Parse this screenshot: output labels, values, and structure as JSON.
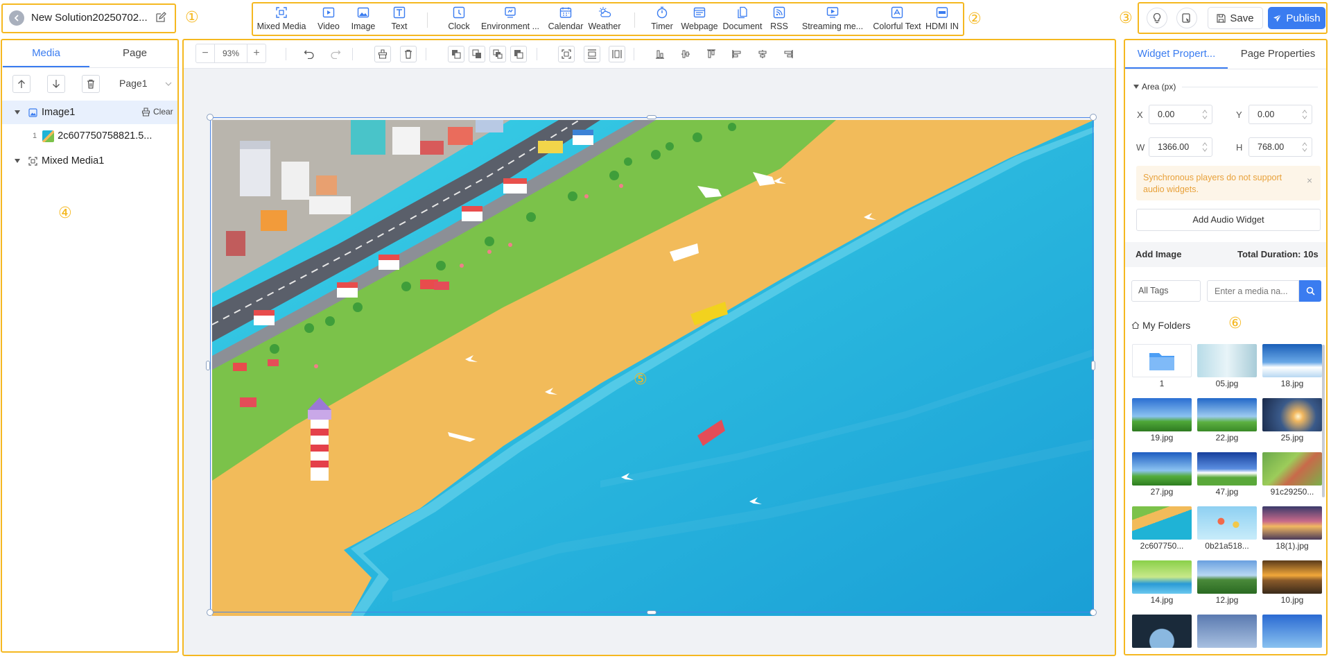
{
  "header": {
    "solution_title": "New Solution20250702...",
    "save_label": "Save",
    "publish_label": "Publish"
  },
  "widgets": [
    {
      "label": "Mixed Media",
      "icon": "mixed-media-icon"
    },
    {
      "label": "Video",
      "icon": "video-icon"
    },
    {
      "label": "Image",
      "icon": "image-icon"
    },
    {
      "label": "Text",
      "icon": "text-icon"
    },
    {
      "label": "Clock",
      "icon": "clock-icon"
    },
    {
      "label": "Environment ...",
      "icon": "environment-icon"
    },
    {
      "label": "Calendar",
      "icon": "calendar-icon"
    },
    {
      "label": "Weather",
      "icon": "weather-icon"
    },
    {
      "label": "Timer",
      "icon": "timer-icon"
    },
    {
      "label": "Webpage",
      "icon": "webpage-icon"
    },
    {
      "label": "Document",
      "icon": "document-icon"
    },
    {
      "label": "RSS",
      "icon": "rss-icon"
    },
    {
      "label": "Streaming me...",
      "icon": "streaming-icon"
    },
    {
      "label": "Colorful Text",
      "icon": "colorful-text-icon"
    },
    {
      "label": "HDMI IN",
      "icon": "hdmi-icon"
    }
  ],
  "annotations": [
    "①",
    "②",
    "③",
    "④",
    "⑤",
    "⑥"
  ],
  "left_panel": {
    "tabs": [
      "Media",
      "Page"
    ],
    "page_select": "Page1",
    "tree": {
      "image1": "Image1",
      "clear": "Clear",
      "file_index": "1",
      "file_name": "2c607750758821.5...",
      "mixed_media": "Mixed Media1"
    }
  },
  "canvas": {
    "zoom": "93%"
  },
  "right_panel": {
    "tabs": [
      "Widget Propert...",
      "Page Properties"
    ],
    "area_label": "Area (px)",
    "fields": {
      "x_label": "X",
      "x": "0.00",
      "y_label": "Y",
      "y": "0.00",
      "w_label": "W",
      "w": "1366.00",
      "h_label": "H",
      "h": "768.00"
    },
    "alert": "Synchronous players do not support audio widgets.",
    "add_audio_label": "Add Audio Widget",
    "add_image_label": "Add Image",
    "total_duration": "Total Duration: 10s",
    "tags_select": "All Tags",
    "search_placeholder": "Enter a media na...",
    "my_folders_label": "My Folders",
    "media": [
      {
        "name": "1",
        "kind": "folder"
      },
      {
        "name": "05.jpg"
      },
      {
        "name": "18.jpg"
      },
      {
        "name": "19.jpg"
      },
      {
        "name": "22.jpg"
      },
      {
        "name": "25.jpg"
      },
      {
        "name": "27.jpg"
      },
      {
        "name": "47.jpg"
      },
      {
        "name": "91c29250..."
      },
      {
        "name": "2c607750..."
      },
      {
        "name": "0b21a518..."
      },
      {
        "name": "18(1).jpg"
      },
      {
        "name": "14.jpg"
      },
      {
        "name": "12.jpg"
      },
      {
        "name": "10.jpg"
      },
      {
        "name": ""
      },
      {
        "name": ""
      },
      {
        "name": ""
      }
    ]
  },
  "colors": {
    "accent": "#3a7cf0",
    "annotation": "#f5b820",
    "alert_text": "#e8a13a",
    "sea": "#1fb3d6",
    "sand": "#f2bb5a",
    "grass": "#7bc24a"
  }
}
